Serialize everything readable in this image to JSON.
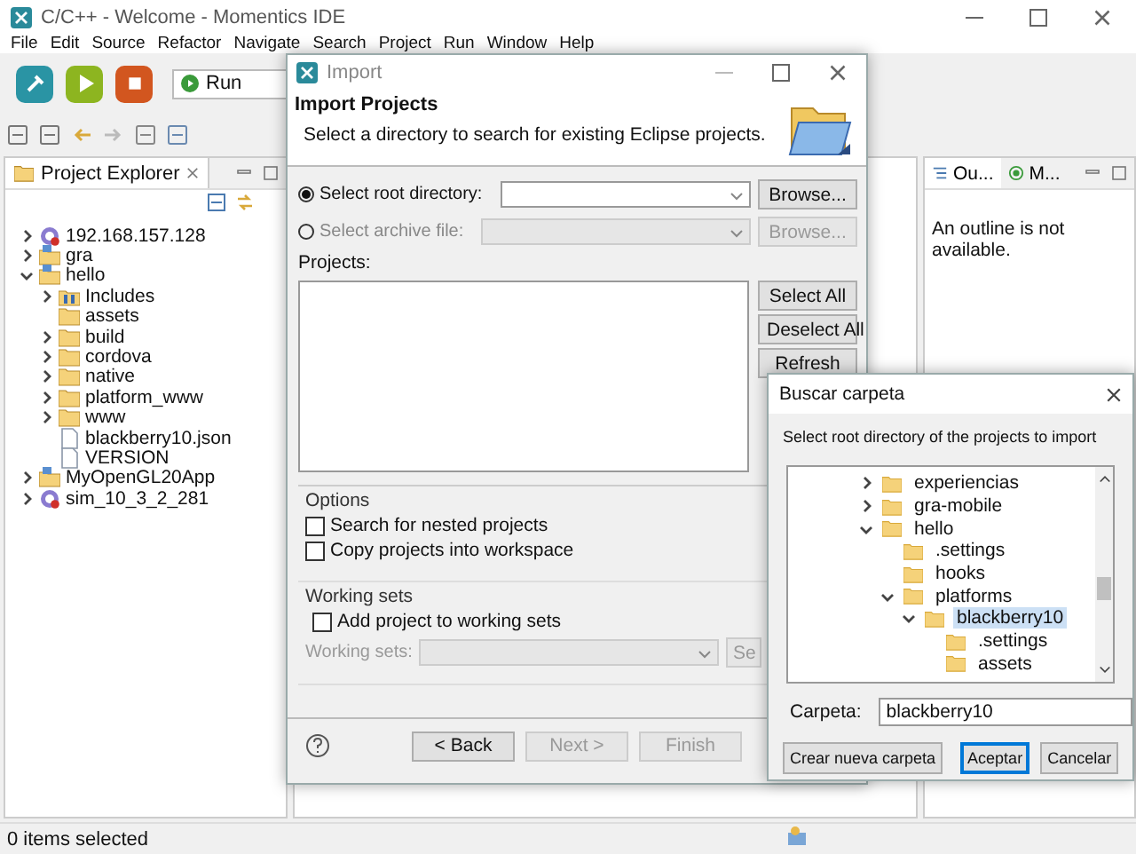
{
  "window": {
    "title": "C/C++ - Welcome - Momentics IDE"
  },
  "menu": [
    "File",
    "Edit",
    "Source",
    "Refactor",
    "Navigate",
    "Search",
    "Project",
    "Run",
    "Window",
    "Help"
  ],
  "toolbar": {
    "run_config": "Run"
  },
  "project_explorer": {
    "title": "Project Explorer",
    "items": [
      {
        "label": "192.168.157.128",
        "kind": "remote",
        "expandable": true,
        "expanded": false
      },
      {
        "label": "gra",
        "kind": "project",
        "expandable": true,
        "expanded": false
      },
      {
        "label": "hello",
        "kind": "project",
        "expandable": true,
        "expanded": true,
        "children": [
          {
            "label": "Includes",
            "kind": "includes",
            "expandable": true,
            "expanded": false
          },
          {
            "label": "assets",
            "kind": "folder",
            "expandable": false,
            "expanded": false
          },
          {
            "label": "build",
            "kind": "folder",
            "expandable": true,
            "expanded": false
          },
          {
            "label": "cordova",
            "kind": "folder",
            "expandable": true,
            "expanded": false
          },
          {
            "label": "native",
            "kind": "folder",
            "expandable": true,
            "expanded": false
          },
          {
            "label": "platform_www",
            "kind": "folder",
            "expandable": true,
            "expanded": false
          },
          {
            "label": "www",
            "kind": "folder",
            "expandable": true,
            "expanded": false
          },
          {
            "label": "blackberry10.json",
            "kind": "file",
            "expandable": false,
            "expanded": false
          },
          {
            "label": "VERSION",
            "kind": "file",
            "expandable": false,
            "expanded": false
          }
        ]
      },
      {
        "label": "MyOpenGL20App",
        "kind": "project",
        "expandable": true,
        "expanded": false
      },
      {
        "label": "sim_10_3_2_281",
        "kind": "remote",
        "expandable": true,
        "expanded": false
      }
    ]
  },
  "outline": {
    "tabs": [
      {
        "label": "Ou...",
        "selected": true
      },
      {
        "label": "M...",
        "selected": false
      }
    ],
    "message": "An outline is not available."
  },
  "status_bar": {
    "text": "0 items selected"
  },
  "import_dialog": {
    "title": "Import",
    "heading": "Import Projects",
    "description": "Select a directory to search for existing Eclipse projects.",
    "sources": [
      {
        "label": "Select root directory:",
        "selected": true,
        "disabled": false,
        "browse": "Browse..."
      },
      {
        "label": "Select archive file:",
        "selected": false,
        "disabled": true,
        "browse": "Browse..."
      }
    ],
    "projects_label": "Projects:",
    "list_buttons": [
      "Select All",
      "Deselect All",
      "Refresh"
    ],
    "options": {
      "title": "Options",
      "checkboxes": [
        {
          "label": "Search for nested projects",
          "checked": false
        },
        {
          "label": "Copy projects into workspace",
          "checked": false
        }
      ]
    },
    "working_sets": {
      "title": "Working sets",
      "checkbox": {
        "label": "Add project to working sets",
        "checked": false
      },
      "field_label": "Working sets:",
      "select_button": "Se",
      "disabled": true
    },
    "buttons": [
      {
        "label": "< Back",
        "disabled": false
      },
      {
        "label": "Next >",
        "disabled": true
      },
      {
        "label": "Finish",
        "disabled": true
      }
    ]
  },
  "folder_dialog": {
    "title": "Buscar carpeta",
    "description": "Select root directory of the projects to import",
    "items": [
      {
        "label": "experiencias",
        "expandable": true,
        "expanded": false,
        "selected": false
      },
      {
        "label": "gra-mobile",
        "expandable": true,
        "expanded": false,
        "selected": false
      },
      {
        "label": "hello",
        "expandable": true,
        "expanded": true,
        "selected": false,
        "children": [
          {
            "label": ".settings",
            "expandable": false,
            "expanded": false,
            "selected": false
          },
          {
            "label": "hooks",
            "expandable": false,
            "expanded": false,
            "selected": false
          },
          {
            "label": "platforms",
            "expandable": true,
            "expanded": true,
            "selected": false,
            "children": [
              {
                "label": "blackberry10",
                "expandable": true,
                "expanded": true,
                "selected": true,
                "children": [
                  {
                    "label": ".settings",
                    "expandable": false,
                    "expanded": false,
                    "selected": false
                  },
                  {
                    "label": "assets",
                    "expandable": false,
                    "expanded": false,
                    "selected": false
                  }
                ]
              }
            ]
          }
        ]
      }
    ],
    "folder_label": "Carpeta:",
    "folder_value": "blackberry10",
    "buttons": [
      {
        "label": "Crear nueva carpeta",
        "default": false
      },
      {
        "label": "Aceptar",
        "default": true
      },
      {
        "label": "Cancelar",
        "default": false
      }
    ]
  }
}
